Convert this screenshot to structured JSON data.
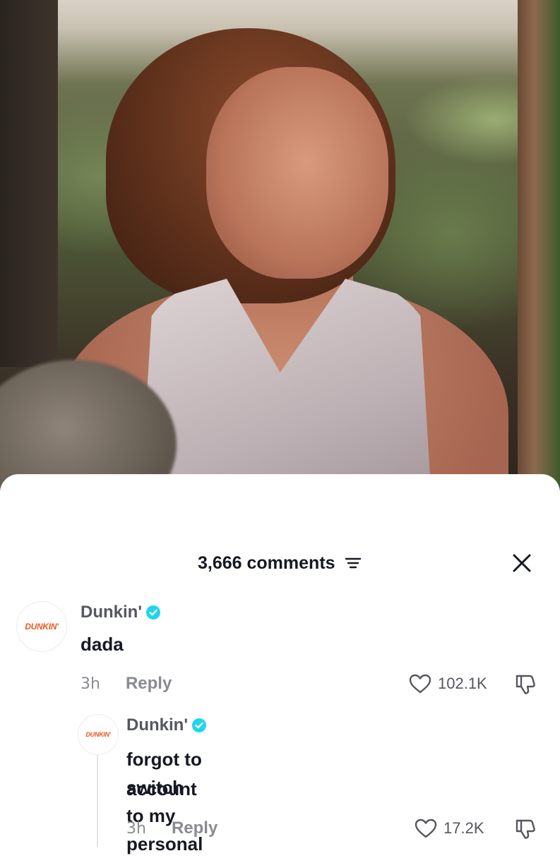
{
  "sheet": {
    "comment_count": "3,666 comments",
    "sort_icon": "sort-filter-icon",
    "close_icon": "close-icon"
  },
  "comments": [
    {
      "avatar_text": "DUNKIN'",
      "username": "Dunkin'",
      "verified": true,
      "text": "dada",
      "timestamp": "3h",
      "reply_label": "Reply",
      "likes": "102.1K"
    }
  ],
  "replies": [
    {
      "avatar_text": "DUNKIN'",
      "username": "Dunkin'",
      "verified": true,
      "text_line1": "forgot to switch to my personal",
      "text_line2": "account",
      "timestamp": "3h",
      "reply_label": "Reply",
      "likes": "17.2K"
    }
  ],
  "colors": {
    "verified": "#20d5ec",
    "brand_orange": "#e85a1d",
    "muted_text": "#8a8b91"
  }
}
